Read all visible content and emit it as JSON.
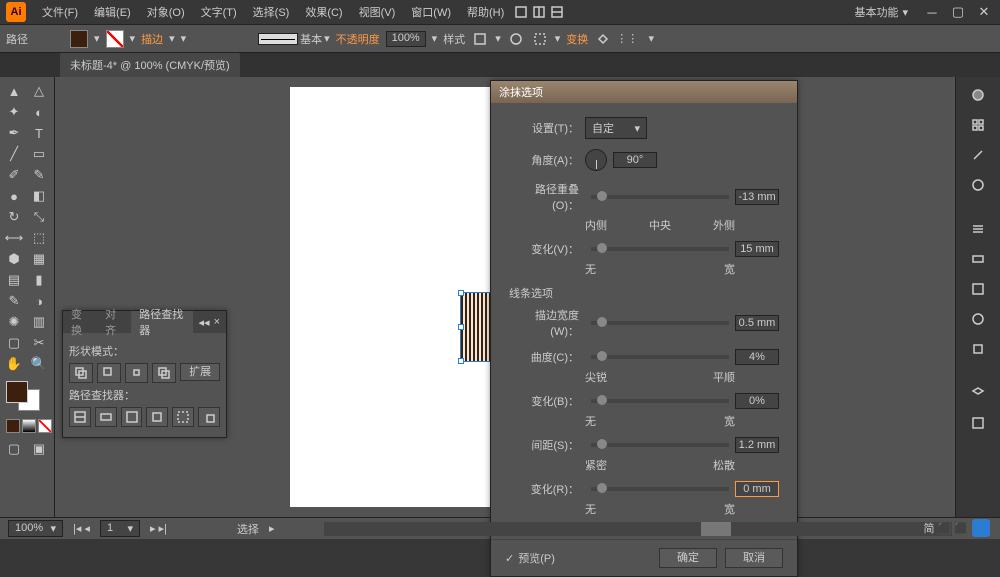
{
  "menubar": {
    "items": [
      "文件(F)",
      "编辑(E)",
      "对象(O)",
      "文字(T)",
      "选择(S)",
      "效果(C)",
      "视图(V)",
      "窗口(W)",
      "帮助(H)"
    ],
    "workspace": "基本功能"
  },
  "optbar": {
    "path_label": "路径",
    "stroke_label": "描边",
    "stroke_style": "基本",
    "opacity_label": "不透明度",
    "opacity": "100%",
    "style_label": "样式",
    "transform_label": "变换"
  },
  "doc_tab": "未标题-4* @ 100% (CMYK/预览)",
  "pathfinder": {
    "tabs": [
      "变换",
      "对齐",
      "路径查找器"
    ],
    "shape_mode": "形状模式：",
    "expand": "扩展",
    "pf_label": "路径查找器："
  },
  "dialog": {
    "title": "涂抹选项",
    "settings": "设置(T)：",
    "settings_val": "自定",
    "angle": "角度(A)：",
    "angle_val": "90°",
    "overlap": "路径重叠(O)：",
    "overlap_val": "-13 mm",
    "overlap_ticks": [
      "内侧",
      "中央",
      "外侧"
    ],
    "var1": "变化(V)：",
    "var1_val": "15 mm",
    "var1_ticks": [
      "无",
      "宽"
    ],
    "line_section": "线条选项",
    "width": "描边宽度(W)：",
    "width_val": "0.5 mm",
    "curve": "曲度(C)：",
    "curve_val": "4%",
    "curve_ticks": [
      "尖锐",
      "平顺"
    ],
    "var2": "变化(B)：",
    "var2_val": "0%",
    "var2_ticks": [
      "无",
      "宽"
    ],
    "spacing": "间距(S)：",
    "spacing_val": "1.2 mm",
    "spacing_ticks": [
      "紧密",
      "松散"
    ],
    "var3": "变化(R)：",
    "var3_val": "0 mm",
    "var3_ticks": [
      "无",
      "宽"
    ],
    "preview": "预览(P)",
    "ok": "确定",
    "cancel": "取消"
  },
  "status": {
    "zoom": "100%",
    "page": "1",
    "mode": "选择",
    "ime": "简 ⬛ ⬛"
  }
}
